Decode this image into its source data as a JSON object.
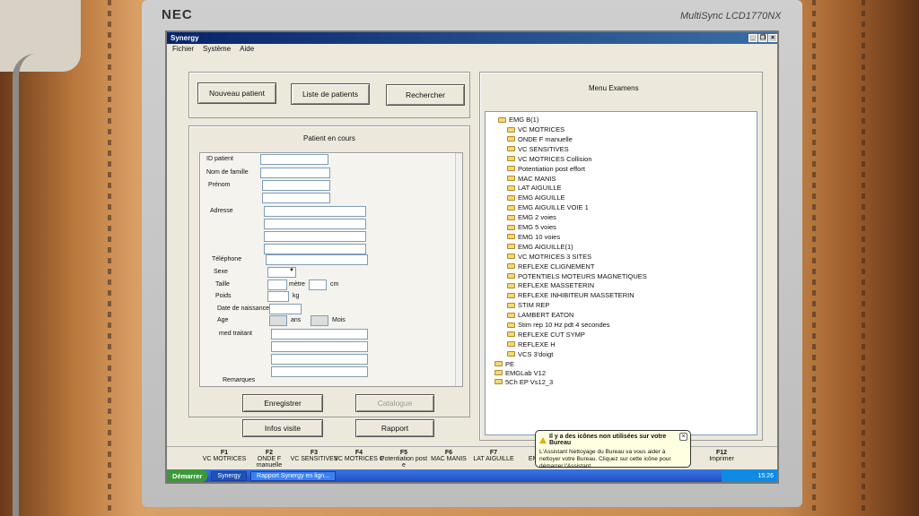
{
  "monitor": {
    "brand": "NEC",
    "model": "MultiSync LCD1770NX"
  },
  "window": {
    "title": "Synergy",
    "controls": [
      "_",
      "❐",
      "×"
    ]
  },
  "menu": [
    "Fichier",
    "Système",
    "Aide"
  ],
  "toolbar": {
    "new_patient": "Nouveau patient",
    "patient_list": "Liste de patients",
    "search": "Rechercher"
  },
  "patient_panel": {
    "title": "Patient en cours",
    "labels": {
      "id": "ID patient",
      "lastname": "Nom de famille",
      "firstname": "Prénom",
      "address": "Adresse",
      "phone": "Téléphone",
      "sex": "Sexe",
      "height": "Taille",
      "meter": "mètre",
      "cm": "cm",
      "weight": "Poids",
      "kg": "kg",
      "birthdate": "Date de naissance",
      "age": "Age",
      "years": "ans",
      "months": "Mois",
      "doctor": "med traitant",
      "remarks": "Remarques"
    }
  },
  "actions": {
    "save": "Enregistrer",
    "catalogue": "Catalogue",
    "info": "Infos visite",
    "report": "Rapport"
  },
  "exams": {
    "title": "Menu Examens",
    "root": "EMG B(1)",
    "items": [
      "VC MOTRICES",
      "ONDE F manuelle",
      "VC SENSITIVES",
      "VC MOTRICES Collision",
      "Potentiation post effort",
      "MAC MANIS",
      "LAT AIGUILLE",
      "EMG AIGUILLE",
      "EMG AIGUILLE VOIE 1",
      "EMG 2 voies",
      "EMG 5 voies",
      "EMG 10 voies",
      "EMG AIGUILLE(1)",
      "VC MOTRICES 3 SITES",
      "REFLEXE CLIGNEMENT",
      "POTENTIELS MOTEURS MAGNETIQUES",
      "REFLEXE MASSETERIN",
      "REFLEXE INHIBITEUR MASSETERIN",
      "STIM REP",
      "LAMBERT EATON",
      "Stim rep 10 Hz pdt 4 secondes",
      "REFLEXE CUT SYMP",
      "REFLEXE H",
      "VCS 3'doigt"
    ],
    "others": [
      "PE",
      "EMGLab V12",
      "5Ch EP Vs12_3"
    ]
  },
  "fkeys": [
    {
      "key": "F1",
      "label": "VC MOTRICES"
    },
    {
      "key": "F2",
      "label": "ONDE F manuelle"
    },
    {
      "key": "F3",
      "label": "VC SENSITIVES"
    },
    {
      "key": "F4",
      "label": "VC MOTRICES C"
    },
    {
      "key": "F5",
      "label": "Potentiation post e"
    },
    {
      "key": "F6",
      "label": "MAC MANIS"
    },
    {
      "key": "F7",
      "label": "LAT AIGUILLE"
    },
    {
      "key": "F8",
      "label": "EMG A"
    },
    {
      "key": "F12",
      "label": "Imprimer"
    }
  ],
  "taskbar": {
    "start": "Démarrer",
    "task1": "Synergy",
    "task2": "Rapport Synergy en lign...",
    "clock": "15:26"
  },
  "balloon": {
    "title": "Il y a des icônes non utilisées sur votre Bureau",
    "body": "L'Assistant Nettoyage du Bureau va vous aider à nettoyer votre Bureau. Cliquez sur cette icône pour démarrer l'Assistant."
  }
}
